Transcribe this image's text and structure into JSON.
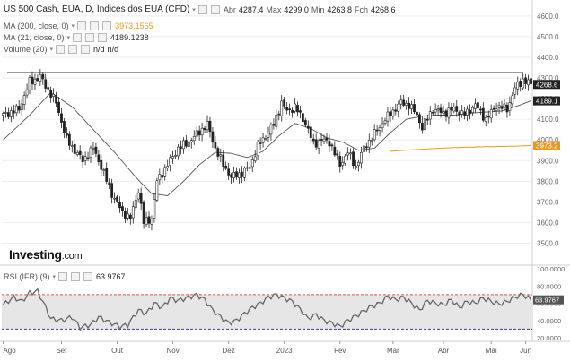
{
  "legend": {
    "title": "US 500 Cash, EUA, D, Índices dos EUA (CFD)",
    "open_label": "Abr",
    "open_value": "4287.4",
    "high_label": "Max",
    "high_value": "4299.0",
    "low_label": "Min",
    "low_value": "4263.8",
    "close_label": "Fch",
    "close_value": "4268.6",
    "ma200_label": "MA (200, close, 0)",
    "ma200_value": "3973.1565",
    "ma21_label": "MA (21, close, 0)",
    "ma21_value": "4189.1238",
    "volume_label": "Volume (20)",
    "volume_value1": "n/d",
    "volume_value2": "n/d"
  },
  "rsi_legend": {
    "label": "RSI (IFR) (9)",
    "value": "63.9767"
  },
  "logo": {
    "main": "Investing",
    "suffix": ".com"
  },
  "colors": {
    "ma200": "#e8981d",
    "ma21": "#555555",
    "candle_up": "#ffffff",
    "candle_down": "#222222",
    "rsi_line": "#666666",
    "rsi_band": "#e6e6e6",
    "rsi_upper": "#d9534f",
    "rsi_lower": "#3a3aa8",
    "grid": "#eeeeee"
  },
  "chart_data": [
    {
      "type": "candlestick",
      "title": "US 500 Cash, EUA, D, Índices dos EUA (CFD)",
      "ylim": [
        3420,
        4660
      ],
      "y_ticks": [
        "4600.0",
        "4500.0",
        "4400.0",
        "4300.0",
        "4200.0",
        "4100.0",
        "4000.0",
        "3900.0",
        "3800.0",
        "3700.0",
        "3600.0",
        "3500.0"
      ],
      "x_ticks": [
        "Ago",
        "Set",
        "Out",
        "Nov",
        "Dez",
        "2023",
        "Fev",
        "Mar",
        "Abr",
        "Mai",
        "Jun"
      ],
      "horizontal_line": 4326,
      "price_badges": [
        {
          "value": "4268.6",
          "level": 4268.6,
          "color": "#222222"
        },
        {
          "value": "4189.1",
          "level": 4189.1,
          "color": "#222222"
        },
        {
          "value": "3973.2",
          "level": 3973.2,
          "color": "#e8981d"
        }
      ],
      "price_path": [
        [
          0,
          4120
        ],
        [
          6,
          4150
        ],
        [
          10,
          4280
        ],
        [
          14,
          4305
        ],
        [
          20,
          4180
        ],
        [
          24,
          4000
        ],
        [
          30,
          3900
        ],
        [
          34,
          3960
        ],
        [
          37,
          3870
        ],
        [
          41,
          3740
        ],
        [
          45,
          3650
        ],
        [
          48,
          3620
        ],
        [
          51,
          3760
        ],
        [
          53,
          3600
        ],
        [
          56,
          3620
        ],
        [
          58,
          3800
        ],
        [
          62,
          3880
        ],
        [
          66,
          3960
        ],
        [
          70,
          3990
        ],
        [
          74,
          4040
        ],
        [
          77,
          4075
        ],
        [
          80,
          3960
        ],
        [
          83,
          3880
        ],
        [
          86,
          3820
        ],
        [
          90,
          3840
        ],
        [
          93,
          3870
        ],
        [
          96,
          3970
        ],
        [
          99,
          4020
        ],
        [
          102,
          4075
        ],
        [
          105,
          4180
        ],
        [
          107,
          4140
        ],
        [
          110,
          4160
        ],
        [
          114,
          4080
        ],
        [
          117,
          3980
        ],
        [
          120,
          4000
        ],
        [
          123,
          3990
        ],
        [
          127,
          3880
        ],
        [
          130,
          3940
        ],
        [
          133,
          3870
        ],
        [
          136,
          3960
        ],
        [
          140,
          4030
        ],
        [
          144,
          4100
        ],
        [
          147,
          4140
        ],
        [
          150,
          4180
        ],
        [
          153,
          4170
        ],
        [
          156,
          4120
        ],
        [
          158,
          4060
        ],
        [
          162,
          4150
        ],
        [
          166,
          4130
        ],
        [
          170,
          4150
        ],
        [
          174,
          4120
        ],
        [
          178,
          4170
        ],
        [
          182,
          4100
        ],
        [
          186,
          4165
        ],
        [
          190,
          4150
        ],
        [
          193,
          4250
        ],
        [
          196,
          4290
        ],
        [
          199,
          4268.6
        ]
      ],
      "ma21_path": [
        [
          0,
          4000
        ],
        [
          10,
          4120
        ],
        [
          18,
          4230
        ],
        [
          26,
          4160
        ],
        [
          34,
          4050
        ],
        [
          42,
          3940
        ],
        [
          50,
          3820
        ],
        [
          56,
          3740
        ],
        [
          62,
          3730
        ],
        [
          68,
          3800
        ],
        [
          74,
          3880
        ],
        [
          80,
          3940
        ],
        [
          86,
          3935
        ],
        [
          92,
          3915
        ],
        [
          98,
          3945
        ],
        [
          104,
          4020
        ],
        [
          110,
          4080
        ],
        [
          116,
          4055
        ],
        [
          122,
          4010
        ],
        [
          128,
          3990
        ],
        [
          134,
          3950
        ],
        [
          140,
          3960
        ],
        [
          146,
          4035
        ],
        [
          152,
          4100
        ],
        [
          158,
          4115
        ],
        [
          164,
          4120
        ],
        [
          170,
          4120
        ],
        [
          176,
          4130
        ],
        [
          182,
          4135
        ],
        [
          188,
          4140
        ],
        [
          194,
          4165
        ],
        [
          199,
          4189.1
        ]
      ],
      "ma200_path": [
        [
          146,
          3945
        ],
        [
          154,
          3952
        ],
        [
          162,
          3958
        ],
        [
          170,
          3963
        ],
        [
          178,
          3966
        ],
        [
          186,
          3968
        ],
        [
          194,
          3970
        ],
        [
          199,
          3973.2
        ]
      ]
    },
    {
      "type": "line",
      "title": "RSI (IFR) (9)",
      "ylim": [
        20,
        100
      ],
      "y_ticks": [
        "100.0000",
        "80.0000",
        "60.0000",
        "40.0000",
        "20.0000"
      ],
      "upper_band": 70,
      "lower_band": 30,
      "last_value": "63.9767",
      "rsi_path": [
        [
          0,
          58
        ],
        [
          4,
          67
        ],
        [
          7,
          62
        ],
        [
          10,
          72
        ],
        [
          13,
          74
        ],
        [
          15,
          62
        ],
        [
          18,
          42
        ],
        [
          22,
          40
        ],
        [
          26,
          44
        ],
        [
          29,
          32
        ],
        [
          33,
          35
        ],
        [
          36,
          44
        ],
        [
          40,
          38
        ],
        [
          44,
          33
        ],
        [
          47,
          35
        ],
        [
          51,
          52
        ],
        [
          54,
          48
        ],
        [
          57,
          60
        ],
        [
          60,
          55
        ],
        [
          63,
          66
        ],
        [
          66,
          63
        ],
        [
          70,
          67
        ],
        [
          73,
          70
        ],
        [
          76,
          64
        ],
        [
          79,
          52
        ],
        [
          82,
          44
        ],
        [
          85,
          37
        ],
        [
          88,
          40
        ],
        [
          91,
          48
        ],
        [
          94,
          55
        ],
        [
          97,
          60
        ],
        [
          100,
          67
        ],
        [
          103,
          70
        ],
        [
          106,
          66
        ],
        [
          109,
          62
        ],
        [
          112,
          53
        ],
        [
          115,
          42
        ],
        [
          118,
          47
        ],
        [
          121,
          40
        ],
        [
          124,
          37
        ],
        [
          127,
          33
        ],
        [
          130,
          40
        ],
        [
          134,
          47
        ],
        [
          138,
          55
        ],
        [
          142,
          60
        ],
        [
          145,
          68
        ],
        [
          148,
          64
        ],
        [
          151,
          67
        ],
        [
          154,
          60
        ],
        [
          157,
          52
        ],
        [
          160,
          63
        ],
        [
          163,
          60
        ],
        [
          166,
          58
        ],
        [
          169,
          64
        ],
        [
          172,
          55
        ],
        [
          175,
          62
        ],
        [
          178,
          60
        ],
        [
          181,
          66
        ],
        [
          184,
          62
        ],
        [
          187,
          59
        ],
        [
          190,
          62
        ],
        [
          193,
          67
        ],
        [
          196,
          70
        ],
        [
          199,
          63.98
        ]
      ]
    }
  ]
}
